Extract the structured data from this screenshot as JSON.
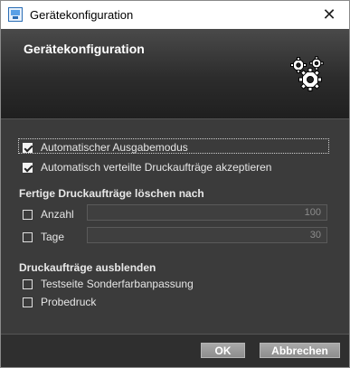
{
  "window": {
    "title": "Gerätekonfiguration",
    "close_glyph": "✕"
  },
  "header": {
    "title": "Gerätekonfiguration",
    "icon": "gears-icon"
  },
  "options": {
    "auto_output_mode": {
      "label": "Automatischer Ausgabemodus",
      "checked": true
    },
    "auto_accept_distributed": {
      "label": "Automatisch verteilte Druckaufträge akzeptieren",
      "checked": true
    }
  },
  "delete_section": {
    "title": "Fertige Druckaufträge löschen nach",
    "count": {
      "label": "Anzahl",
      "checked": false,
      "value": "100"
    },
    "days": {
      "label": "Tage",
      "checked": false,
      "value": "30"
    }
  },
  "hide_section": {
    "title": "Druckaufträge ausblenden",
    "test_page": {
      "label": "Testseite Sonderfarbanpassung",
      "checked": false
    },
    "proof": {
      "label": "Probedruck",
      "checked": false
    }
  },
  "buttons": {
    "ok": "OK",
    "cancel": "Abbrechen"
  }
}
